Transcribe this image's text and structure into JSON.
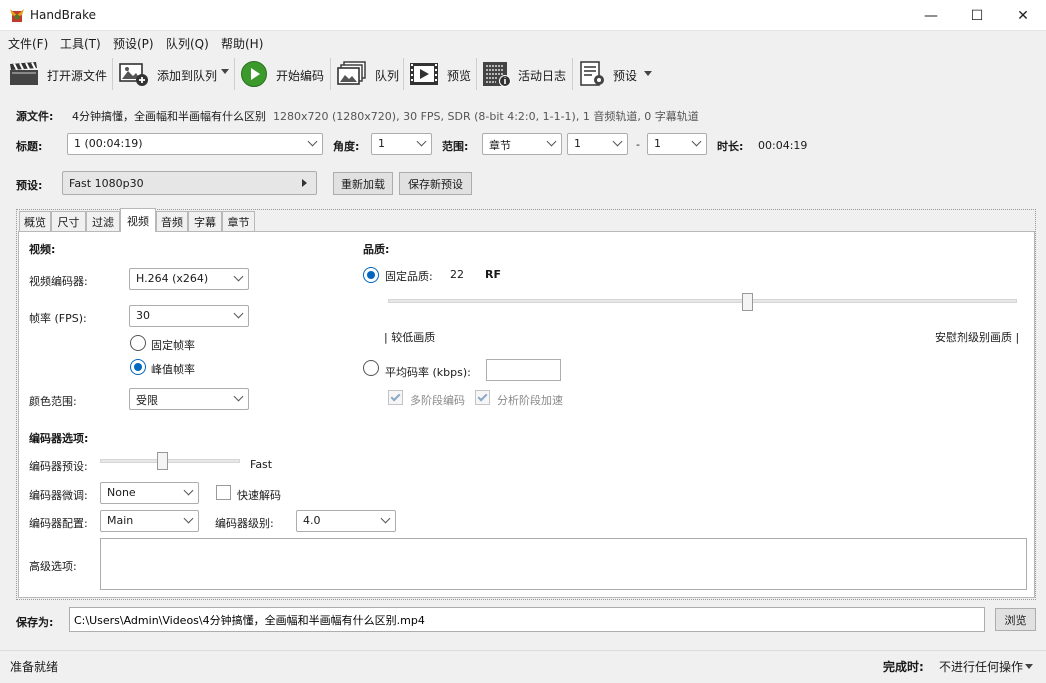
{
  "window": {
    "title": "HandBrake",
    "minimize": "—",
    "maximize": "☐",
    "close": "✕"
  },
  "menu": [
    "文件(F)",
    "工具(T)",
    "预设(P)",
    "队列(Q)",
    "帮助(H)"
  ],
  "toolbar": {
    "open_source": "打开源文件",
    "add_to_queue": "添加到队列",
    "start_encode": "开始编码",
    "queue": "队列",
    "preview": "预览",
    "activity_log": "活动日志",
    "presets": "预设"
  },
  "source": {
    "label": "源文件:",
    "name": "4分钟搞懂，全画幅和半画幅有什么区别",
    "info": "1280x720 (1280x720), 30 FPS, SDR (8-bit 4:2:0, 1-1-1), 1 音频轨道, 0 字幕轨道"
  },
  "title_row": {
    "title_label": "标题:",
    "title_value": "1  (00:04:19)",
    "angle_label": "角度:",
    "angle_value": "1",
    "range_label": "范围:",
    "range_type": "章节",
    "range_start": "1",
    "range_dash": "-",
    "range_end": "1",
    "duration_label": "时长:",
    "duration_value": "00:04:19"
  },
  "preset_row": {
    "label": "预设:",
    "value": "Fast 1080p30",
    "reload": "重新加载",
    "save_new": "保存新预设"
  },
  "tabs": [
    "概览",
    "尺寸",
    "过滤",
    "视频",
    "音频",
    "字幕",
    "章节"
  ],
  "video": {
    "section_title": "视频:",
    "encoder_label": "视频编码器:",
    "encoder_value": "H.264 (x264)",
    "fps_label": "帧率 (FPS):",
    "fps_value": "30",
    "constant_fr": "固定帧率",
    "peak_fr": "峰值帧率",
    "color_range_label": "颜色范围:",
    "color_range_value": "受限"
  },
  "quality": {
    "section_title": "品质:",
    "constant_quality": "固定品质:",
    "cq_value": "22",
    "cq_unit": "RF",
    "low_label": "| 较低画质",
    "high_label": "安慰剂级别画质 |",
    "avg_bitrate": "平均码率 (kbps):",
    "avg_bitrate_value": "",
    "multipass": "多阶段编码",
    "turbo": "分析阶段加速",
    "slider_fraction": 0.57
  },
  "encoder_options": {
    "section_title": "编码器选项:",
    "preset_label": "编码器预设:",
    "preset_value": "Fast",
    "tune_label": "编码器微调:",
    "tune_value": "None",
    "fast_decode": "快速解码",
    "profile_label": "编码器配置:",
    "profile_value": "Main",
    "level_label": "编码器级别:",
    "level_value": "4.0",
    "advanced_label": "高级选项:",
    "advanced_value": ""
  },
  "save_row": {
    "label": "保存为:",
    "path": "C:\\Users\\Admin\\Videos\\4分钟搞懂，全画幅和半画幅有什么区别.mp4",
    "browse": "浏览"
  },
  "status": {
    "ready": "准备就绪",
    "when_done_label": "完成时:",
    "when_done_value": "不进行任何操作"
  }
}
